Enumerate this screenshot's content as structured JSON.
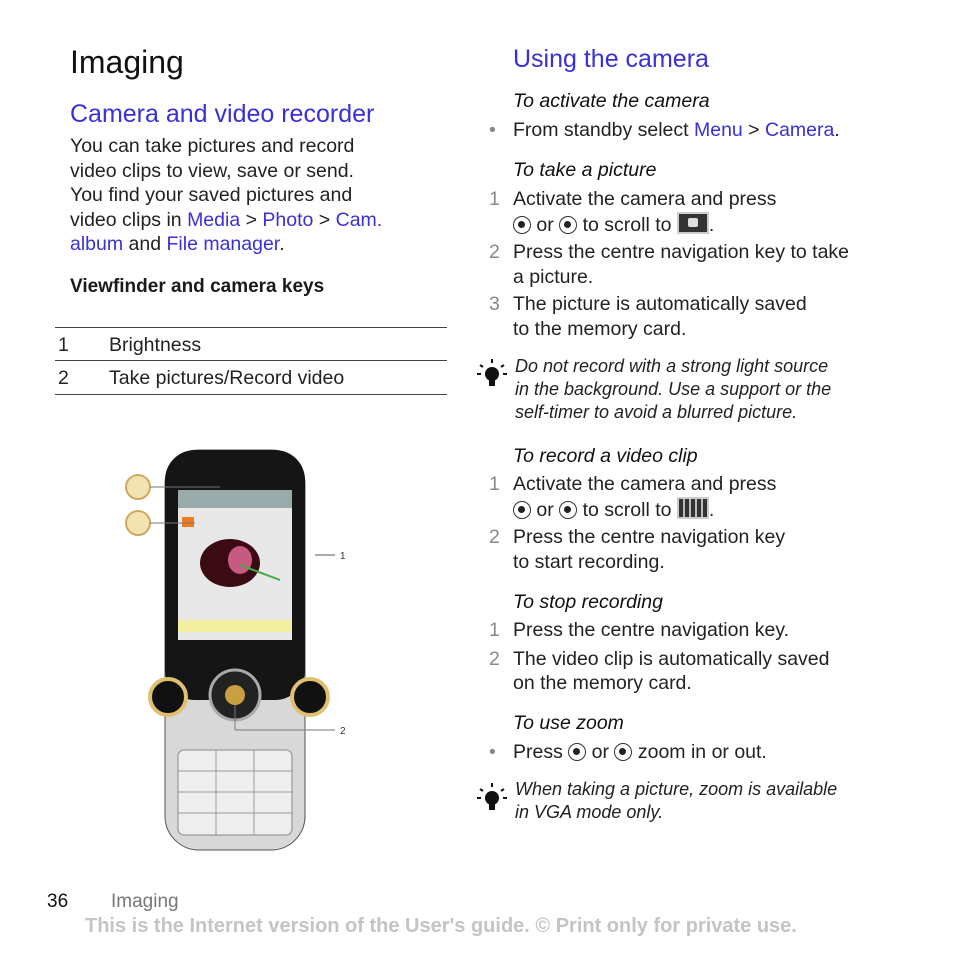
{
  "left": {
    "title": "Imaging",
    "section_title": "Camera and video recorder",
    "intro_line1": "You can take pictures and record",
    "intro_line2": "video clips to view, save or send.",
    "intro_line3": "You find your saved pictures and",
    "intro_line4_pre": "video clips in ",
    "link_media": "Media",
    "sep": " > ",
    "link_photo": "Photo",
    "link_cam": "Cam.",
    "link_album": "album",
    "and": " and ",
    "link_filemanager": "File manager",
    "period": ".",
    "keys_heading": "Viewfinder and camera keys",
    "table": [
      {
        "num": "1",
        "label": "Brightness"
      },
      {
        "num": "2",
        "label": "Take pictures/Record video"
      }
    ],
    "callouts": [
      "1",
      "2"
    ]
  },
  "right": {
    "title": "Using the camera",
    "activate_heading": "To activate the camera",
    "activate_bullet_pre": "From standby select ",
    "activate_menu": "Menu",
    "activate_camera": "Camera",
    "take_heading": "To take a picture",
    "take_steps": [
      {
        "n": "1",
        "l1": "Activate the camera and press",
        "l2_or": " or ",
        "l2_post": " to scroll to "
      },
      {
        "n": "2",
        "l1": "Press the centre navigation key to take",
        "l2": "a picture."
      },
      {
        "n": "3",
        "l1": "The picture is automatically saved",
        "l2": "to the memory card."
      }
    ],
    "tip1": [
      "Do not record with a strong light source",
      "in the background. Use a support or the",
      "self-timer to avoid a blurred picture."
    ],
    "record_heading": "To record a video clip",
    "record_steps": [
      {
        "n": "1",
        "l1": "Activate the camera and press",
        "l2_or": " or ",
        "l2_post": " to scroll to "
      },
      {
        "n": "2",
        "l1": "Press the centre navigation key",
        "l2": "to start recording."
      }
    ],
    "stop_heading": "To stop recording",
    "stop_steps": [
      {
        "n": "1",
        "l1": "Press the centre navigation key."
      },
      {
        "n": "2",
        "l1": "The video clip is automatically saved",
        "l2": "on the memory card."
      }
    ],
    "zoom_heading": "To use zoom",
    "zoom_pre": "Press ",
    "zoom_or": " or ",
    "zoom_post": " zoom in or out.",
    "tip2": [
      "When taking a picture, zoom is available",
      "in VGA mode only."
    ]
  },
  "footer": {
    "page": "36",
    "section": "Imaging",
    "notice": "This is the Internet version of the User's guide. © Print only for private use."
  }
}
